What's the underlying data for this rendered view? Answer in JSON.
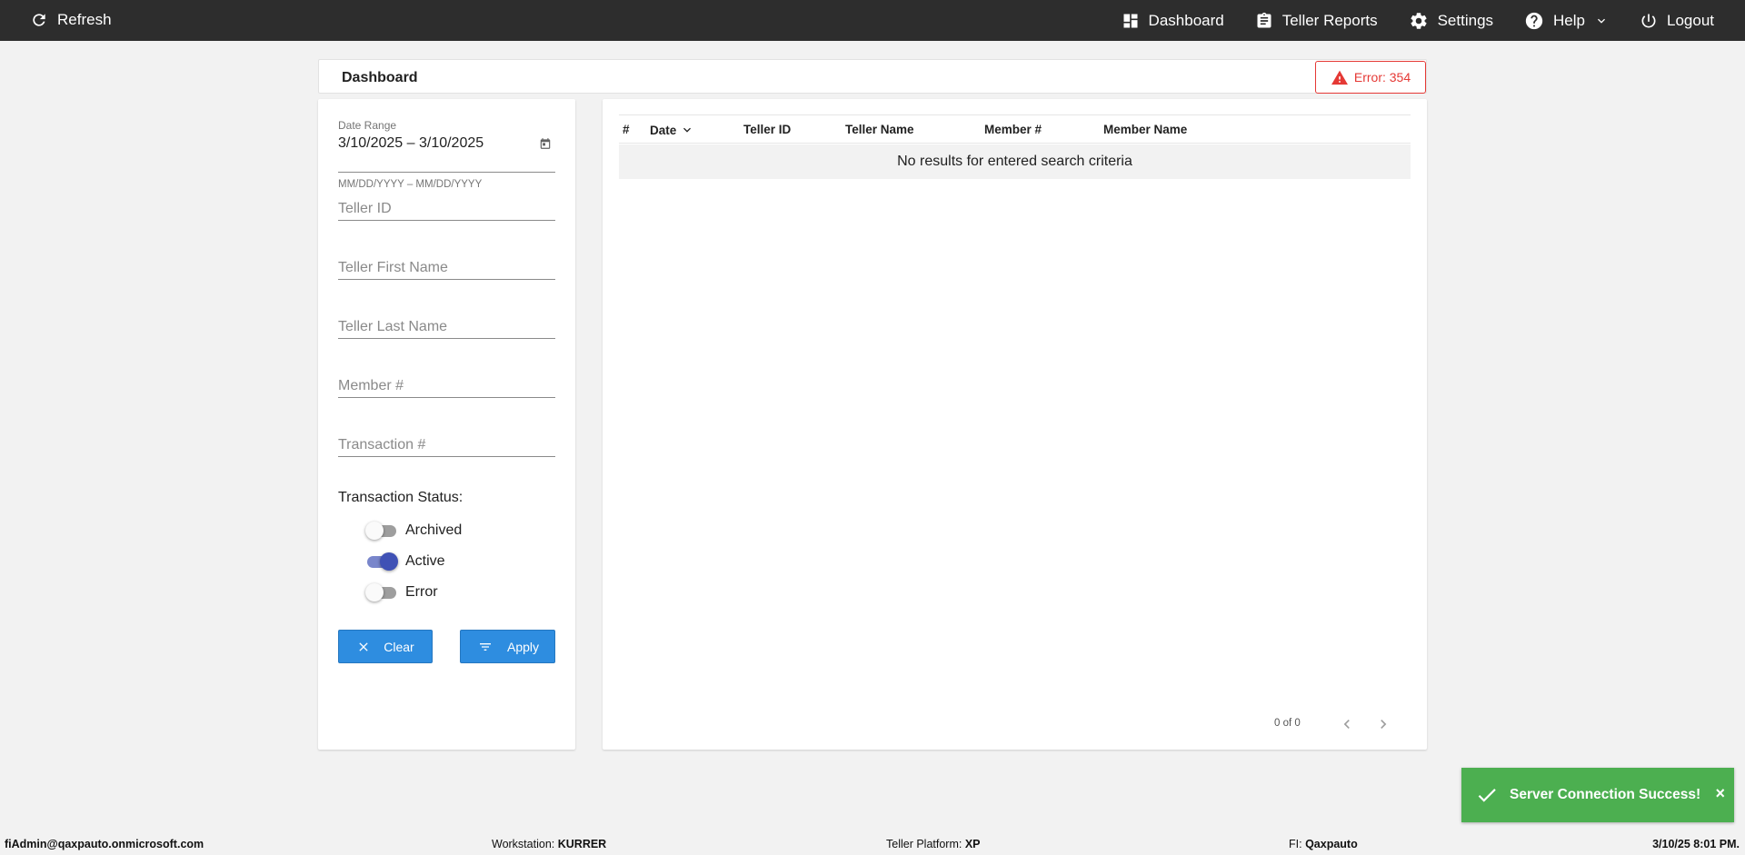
{
  "nav": {
    "refresh": "Refresh",
    "dashboard": "Dashboard",
    "teller_reports": "Teller Reports",
    "settings": "Settings",
    "help": "Help",
    "logout": "Logout"
  },
  "header": {
    "title": "Dashboard",
    "error_badge": "Error: 354",
    "error_color": "#e53935"
  },
  "filters": {
    "date_range_label": "Date Range",
    "date_range_value": "3/10/2025 – 3/10/2025",
    "date_range_hint": "MM/DD/YYYY – MM/DD/YYYY",
    "teller_id_placeholder": "Teller ID",
    "teller_first_name_placeholder": "Teller First Name",
    "teller_last_name_placeholder": "Teller Last Name",
    "member_placeholder": "Member #",
    "transaction_placeholder": "Transaction #",
    "status_label": "Transaction Status:",
    "statuses": [
      {
        "label": "Archived",
        "on": false
      },
      {
        "label": "Active",
        "on": true
      },
      {
        "label": "Error",
        "on": false
      }
    ],
    "clear_label": "Clear",
    "apply_label": "Apply",
    "button_color": "#2e8de0"
  },
  "table": {
    "columns": [
      "#",
      "Date",
      "Teller ID",
      "Teller Name",
      "Member #",
      "Member Name"
    ],
    "empty_message": "No results for entered search criteria",
    "pager_text": "0 of 0"
  },
  "toast": {
    "message": "Server Connection Success!",
    "close": "×",
    "color": "#4caf50"
  },
  "footer": {
    "user": "fiAdmin@qaxpauto.onmicrosoft.com",
    "workstation_label": "Workstation:",
    "workstation_value": "KURRER",
    "platform_label": "Teller Platform:",
    "platform_value": "XP",
    "fi_label": "FI:",
    "fi_value": "Qaxpauto",
    "datetime": "3/10/25 8:01 PM."
  }
}
